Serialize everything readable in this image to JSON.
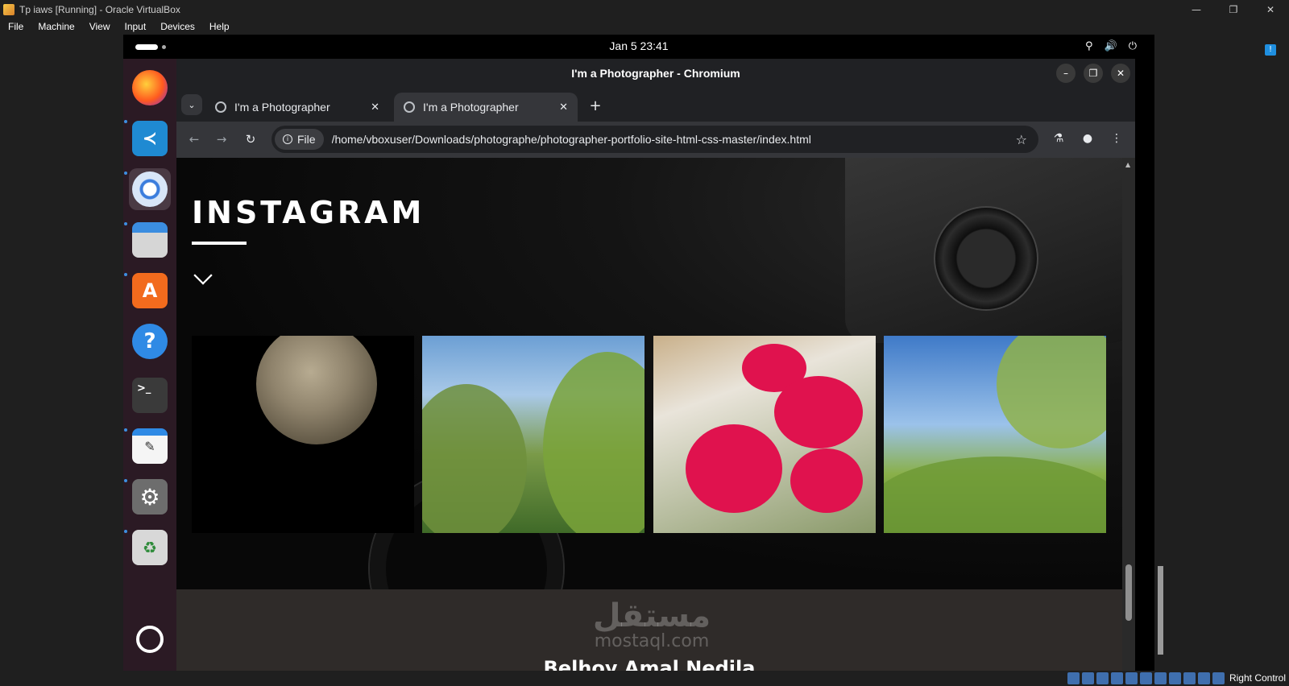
{
  "host": {
    "title": "Tp iaws [Running] - Oracle VirtualBox",
    "window_buttons": [
      "—",
      "❐",
      "✕"
    ],
    "menu": [
      "File",
      "Machine",
      "View",
      "Input",
      "Devices",
      "Help"
    ],
    "status_host_key": "Right Control"
  },
  "gnome": {
    "clock": "Jan 5  23:41",
    "tray": [
      "network-icon",
      "volume-icon",
      "power-icon"
    ]
  },
  "dock": {
    "apps": [
      "Firefox",
      "Visual Studio Code",
      "Chromium",
      "Files",
      "App Center",
      "Help",
      "Terminal",
      "Text Editor",
      "Settings",
      "Trash"
    ],
    "apps_grid": "Show Apps"
  },
  "browser": {
    "window_title": "I'm a Photographer - Chromium",
    "tabs": [
      {
        "label": "I'm a Photographer",
        "active": false
      },
      {
        "label": "I'm a Photographer",
        "active": true
      }
    ],
    "new_tab": "+",
    "chip_label": "File",
    "url": "/home/vboxuser/Downloads/photographe/photographer-portfolio-site-html-css-master/index.html"
  },
  "page": {
    "heading": "INSTAGRAM",
    "footer_name": "Belhoy Amal Nedila",
    "watermark_ar": "مستقل",
    "watermark_en": "mostaql.com",
    "photos": [
      "moon",
      "trees",
      "bougainvillea",
      "trees-sky"
    ]
  },
  "colors": {
    "dock_bg": "#2b1a24",
    "chrome_bg": "#202124",
    "toolbar_bg": "#35363a",
    "footer_bg": "#2f2b29",
    "flower": "#e0124e"
  }
}
